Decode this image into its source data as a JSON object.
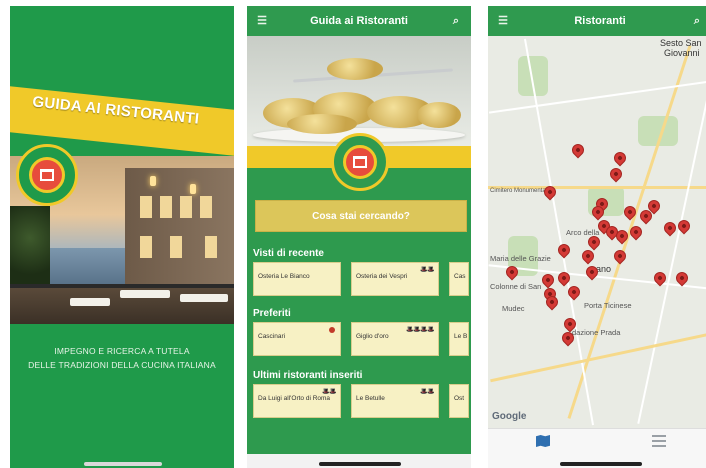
{
  "splash": {
    "title": "GUIDA AI RISTORANTI",
    "tagline_line1": "IMPEGNO E RICERCA A TUTELA",
    "tagline_line2": "DELLE TRADIZIONI DELLA CUCINA ITALIANA"
  },
  "home": {
    "title": "Guida ai Ristoranti",
    "menu_icon": "menu-icon",
    "search_icon": "search-icon",
    "search_label": "Cosa stai cercando?",
    "sections": [
      {
        "title": "Visti di recente",
        "cards": [
          {
            "name": "Osteria Le Bianco",
            "hats": ""
          },
          {
            "name": "Osteria dei Vespri",
            "hats": "🎩🎩"
          },
          {
            "name": "Cas",
            "hats": ""
          }
        ]
      },
      {
        "title": "Preferiti",
        "cards": [
          {
            "name": "Cascinari",
            "hats": "●"
          },
          {
            "name": "Giglio d'oro",
            "hats": "🎩🎩🎩🎩"
          },
          {
            "name": "Le B",
            "hats": ""
          }
        ]
      },
      {
        "title": "Ultimi ristoranti inseriti",
        "cards": [
          {
            "name": "Da Luigi all'Orto di Roma",
            "hats": "🎩🎩"
          },
          {
            "name": "Le Betulle",
            "hats": "🎩🎩"
          },
          {
            "name": "Ost",
            "hats": ""
          }
        ]
      }
    ]
  },
  "map_screen": {
    "title": "Ristoranti",
    "labels": {
      "sesto": "Sesto San",
      "giovanni": "Giovanni",
      "arco": "Arco della",
      "maria": "Maria delle Grazie",
      "colonne": "Colonne di San",
      "mudec": "Mudec",
      "ticinese": "Porta Ticinese",
      "prada": "dazione Prada",
      "milano": "ano",
      "cimitero": "Cimitero Monumentale"
    },
    "google": "Google",
    "tabs": {
      "map": "map-tab-icon",
      "list": "list-tab-icon"
    }
  },
  "colors": {
    "green": "#2f9a4f",
    "yellow": "#f0c929",
    "card": "#f7f1c4",
    "pin": "#d43a36"
  }
}
